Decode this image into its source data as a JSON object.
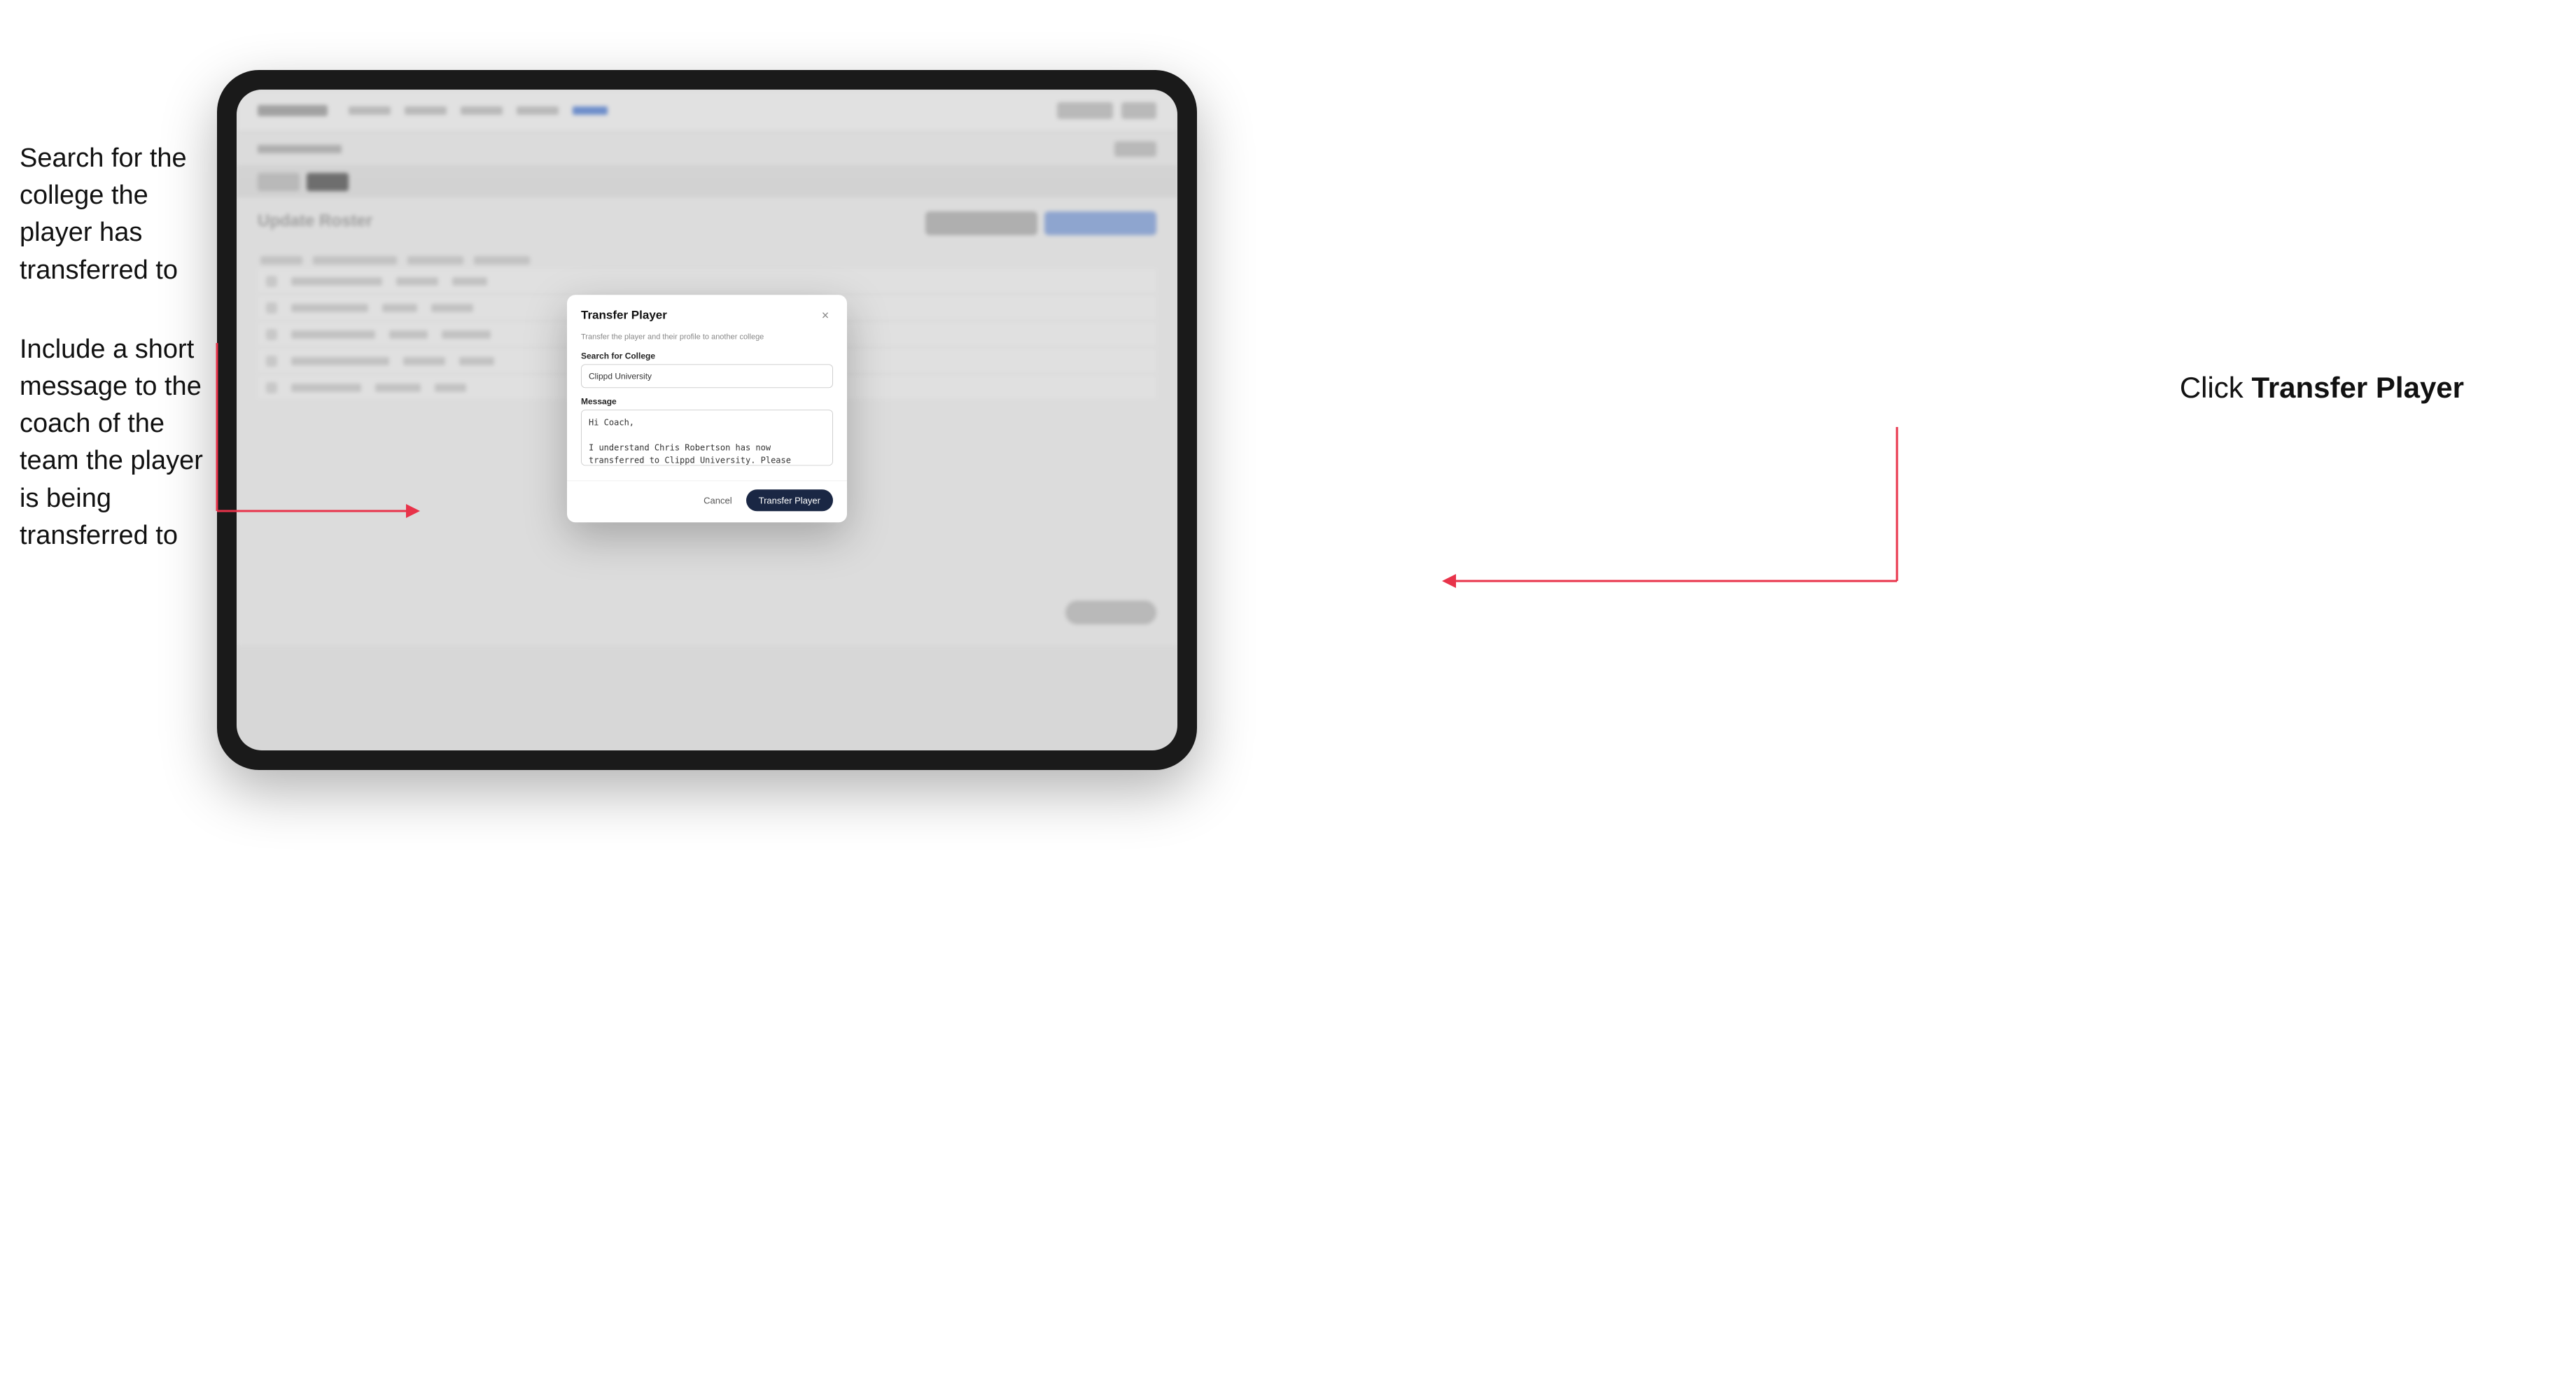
{
  "annotations": {
    "left_top": "Search for the college the player has transferred to",
    "left_bottom": "Include a short message to the coach of the team the player is being transferred to",
    "right": "Click ",
    "right_bold": "Transfer Player"
  },
  "modal": {
    "title": "Transfer Player",
    "subtitle": "Transfer the player and their profile to another college",
    "search_label": "Search for College",
    "search_value": "Clippd University",
    "message_label": "Message",
    "message_value": "Hi Coach,\n\nI understand Chris Robertson has now transferred to Clippd University. Please accept this transfer request when you can.",
    "cancel_label": "Cancel",
    "transfer_label": "Transfer Player",
    "close_icon": "×"
  },
  "bg": {
    "section_title": "Update Roster"
  }
}
